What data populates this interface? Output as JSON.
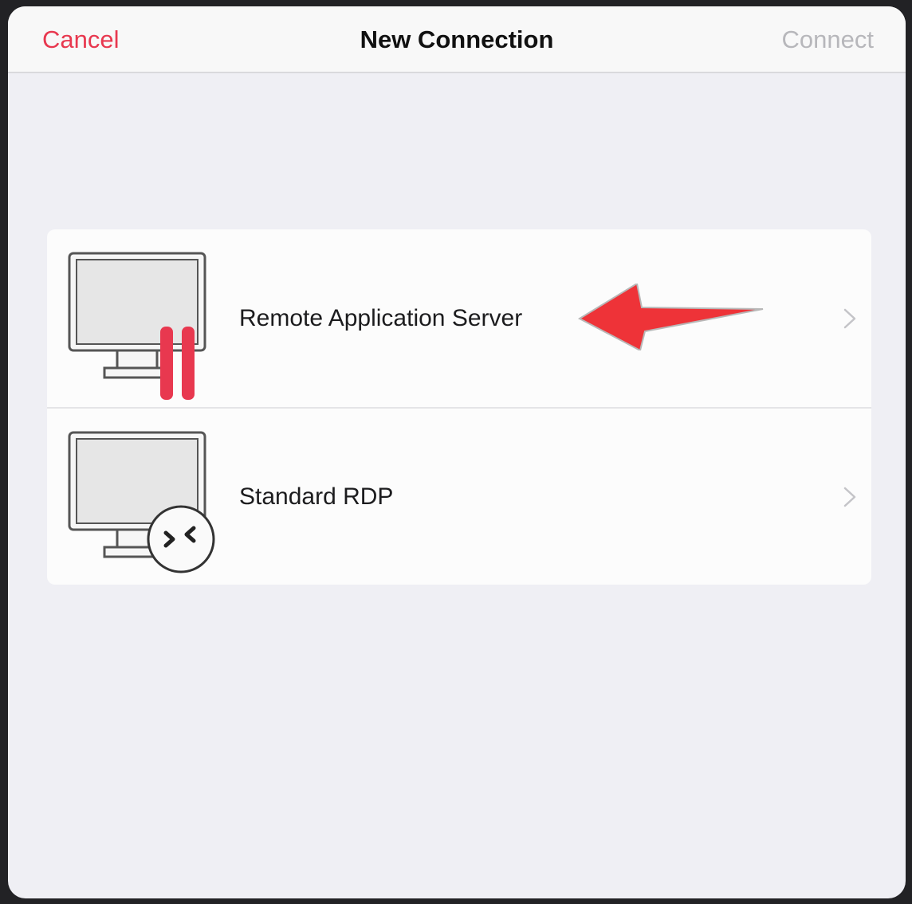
{
  "navbar": {
    "cancel_label": "Cancel",
    "title": "New Connection",
    "connect_label": "Connect"
  },
  "options": [
    {
      "label": "Remote Application Server",
      "icon": "ras-monitor-icon"
    },
    {
      "label": "Standard RDP",
      "icon": "rdp-monitor-icon"
    }
  ],
  "colors": {
    "accent": "#e8384f",
    "disabled": "#b7b7bb",
    "arrow": "#ee3338",
    "background": "#efeff4"
  }
}
